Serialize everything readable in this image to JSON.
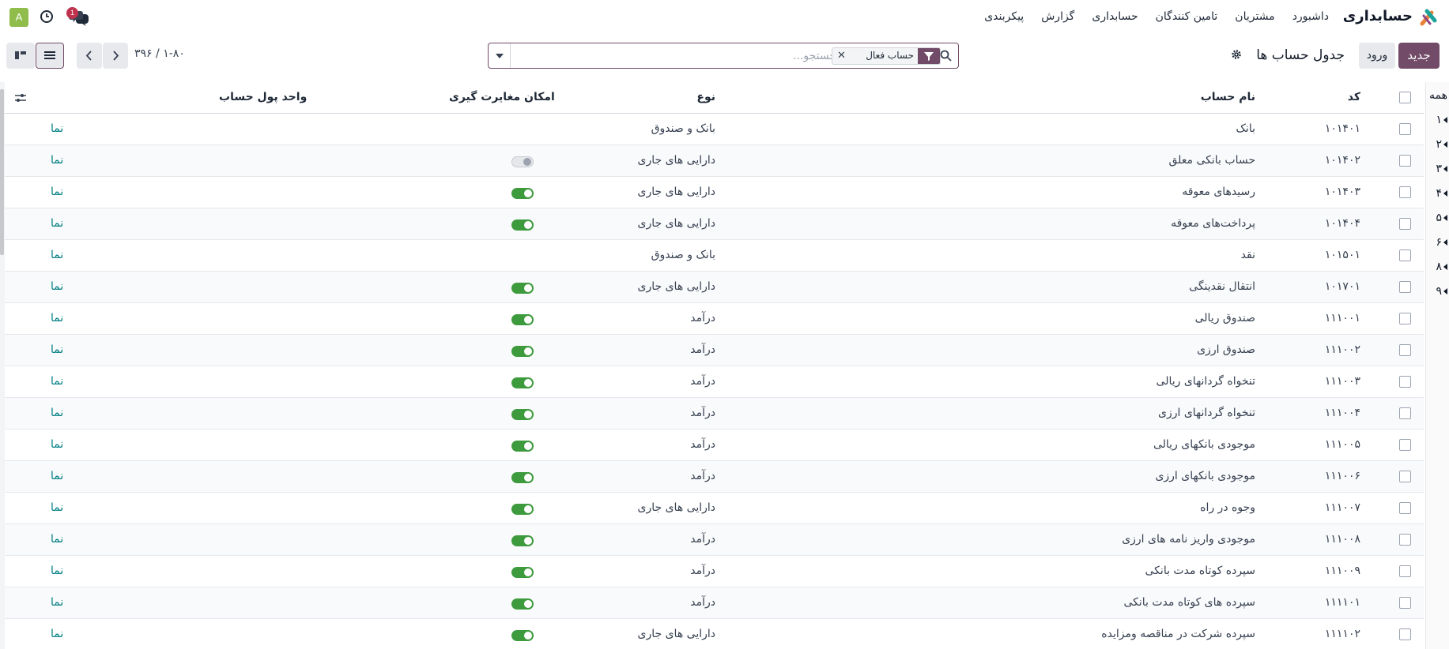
{
  "app": {
    "title": "حسابداری",
    "avatar_letter": "A",
    "chat_badge": "1",
    "brand_color": "#714b67"
  },
  "menu": [
    "داشبورد",
    "مشتریان",
    "تامین کنندگان",
    "حسابداری",
    "گزارش",
    "پیکربندی"
  ],
  "control": {
    "new_label": "جدید",
    "import_label": "ورود",
    "breadcrumb": "جدول حساب ها",
    "search_placeholder": "جستجو...",
    "facet_label": "حساب فعال",
    "pager": "۱-۸۰ / ۳۹۶"
  },
  "alpha": [
    "همه",
    "۱",
    "۲",
    "۳",
    "۴",
    "۵",
    "۶",
    "۸",
    "۹"
  ],
  "columns": {
    "code": "کد",
    "name": "نام حساب",
    "type": "نوع",
    "reconcile": "امکان مغایرت گیری",
    "currency": "واحد پول حساب"
  },
  "rows": [
    {
      "code": "۱۰۱۴۰۱",
      "name": "بانک",
      "type": "بانک و صندوق",
      "reconcile": "none",
      "currency": "نما"
    },
    {
      "code": "۱۰۱۴۰۲",
      "name": "حساب بانکی معلق",
      "type": "دارایی های جاری",
      "reconcile": "off",
      "currency": "نما"
    },
    {
      "code": "۱۰۱۴۰۳",
      "name": "رسیدهای معوقه",
      "type": "دارایی های جاری",
      "reconcile": "on",
      "currency": "نما"
    },
    {
      "code": "۱۰۱۴۰۴",
      "name": "پرداخت‌های معوقه",
      "type": "دارایی های جاری",
      "reconcile": "on",
      "currency": "نما"
    },
    {
      "code": "۱۰۱۵۰۱",
      "name": "نقد",
      "type": "بانک و صندوق",
      "reconcile": "none",
      "currency": "نما"
    },
    {
      "code": "۱۰۱۷۰۱",
      "name": "انتقال نقدینگی",
      "type": "دارایی های جاری",
      "reconcile": "on",
      "currency": "نما"
    },
    {
      "code": "۱۱۱۰۰۱",
      "name": "صندوق ریالی",
      "type": "درآمد",
      "reconcile": "on",
      "currency": "نما"
    },
    {
      "code": "۱۱۱۰۰۲",
      "name": "صندوق ارزی",
      "type": "درآمد",
      "reconcile": "on",
      "currency": "نما"
    },
    {
      "code": "۱۱۱۰۰۳",
      "name": "تنخواه گردانهای ریالی",
      "type": "درآمد",
      "reconcile": "on",
      "currency": "نما"
    },
    {
      "code": "۱۱۱۰۰۴",
      "name": "تنخواه گردانهای ارزی",
      "type": "درآمد",
      "reconcile": "on",
      "currency": "نما"
    },
    {
      "code": "۱۱۱۰۰۵",
      "name": "موجودی بانکهای ریالی",
      "type": "درآمد",
      "reconcile": "on",
      "currency": "نما"
    },
    {
      "code": "۱۱۱۰۰۶",
      "name": "موجودی بانکهای ارزی",
      "type": "درآمد",
      "reconcile": "on",
      "currency": "نما"
    },
    {
      "code": "۱۱۱۰۰۷",
      "name": "وجوه در راه",
      "type": "دارایی های جاری",
      "reconcile": "on",
      "currency": "نما"
    },
    {
      "code": "۱۱۱۰۰۸",
      "name": "موجودی واریز نامه های ارزی",
      "type": "درآمد",
      "reconcile": "on",
      "currency": "نما"
    },
    {
      "code": "۱۱۱۰۰۹",
      "name": "سپرده کوتاه مدت بانکی",
      "type": "درآمد",
      "reconcile": "on",
      "currency": "نما"
    },
    {
      "code": "۱۱۱۱۰۱",
      "name": "سپرده های کوتاه مدت بانکی",
      "type": "درآمد",
      "reconcile": "on",
      "currency": "نما"
    },
    {
      "code": "۱۱۱۱۰۲",
      "name": "سپرده شرکت در مناقصه ومزایده",
      "type": "دارایی های جاری",
      "reconcile": "on",
      "currency": "نما"
    }
  ]
}
